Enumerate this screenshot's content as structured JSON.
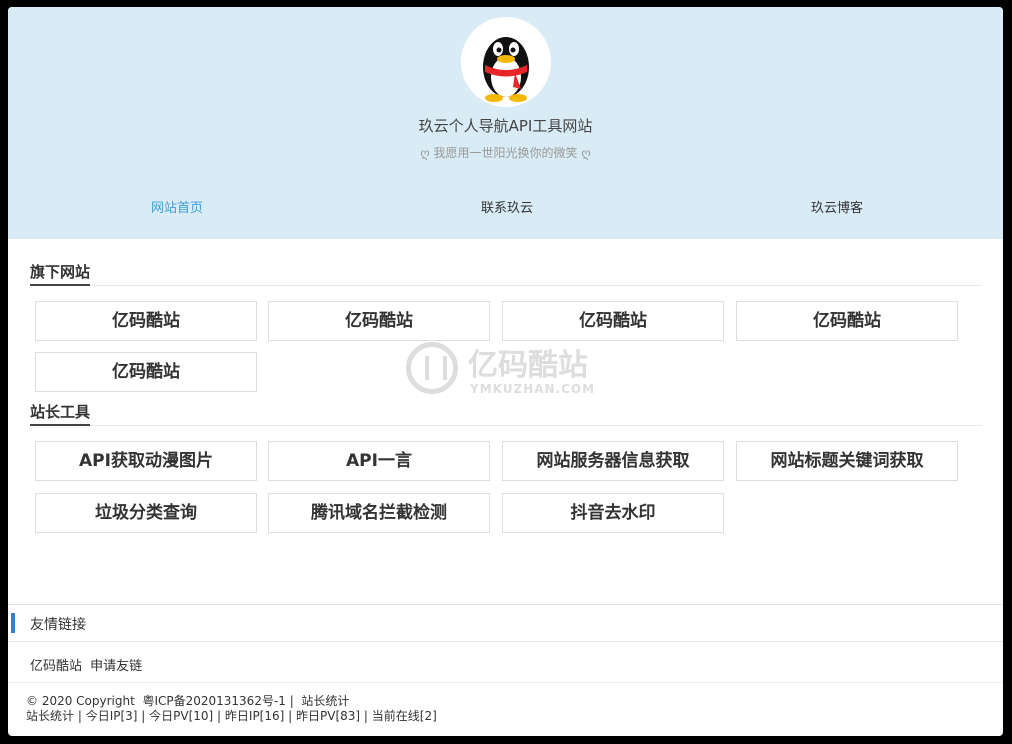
{
  "header": {
    "site_title": "玖云个人导航API工具网站",
    "motto": "ღ 我愿用一世阳光换你的微笑 ღ",
    "avatar_icon": "qq-penguin-icon"
  },
  "nav": [
    {
      "label": "网站首页",
      "active": true
    },
    {
      "label": "联系玖云",
      "active": false
    },
    {
      "label": "玖云博客",
      "active": false
    }
  ],
  "sections": [
    {
      "title": "旗下网站",
      "items": [
        "亿码酷站",
        "亿码酷站",
        "亿码酷站",
        "亿码酷站",
        "亿码酷站"
      ]
    },
    {
      "title": "站长工具",
      "items": [
        "API获取动漫图片",
        "API一言",
        "网站服务器信息获取",
        "网站标题关键词获取",
        "垃圾分类查询",
        "腾讯域名拦截检测",
        "抖音去水印"
      ]
    }
  ],
  "watermark": {
    "cn": "亿码酷站",
    "en": "YMKUZHAN.COM"
  },
  "friend_links": {
    "title": "友情链接",
    "links": [
      "亿码酷站",
      "申请友链"
    ]
  },
  "footer": {
    "line1_copyright": "© 2020 Copyright",
    "line1_icp": "粤ICP备2020131362号-1",
    "line1_stats": "站长统计",
    "line2": [
      "站长统计",
      "今日IP[3]",
      "今日PV[10]",
      "昨日IP[16]",
      "昨日PV[83]",
      "当前在线[2]"
    ]
  },
  "colors": {
    "hero_bg": "#d9ecf5",
    "nav_active": "#3aa0d8",
    "accent_bar": "#3a7fc0"
  }
}
